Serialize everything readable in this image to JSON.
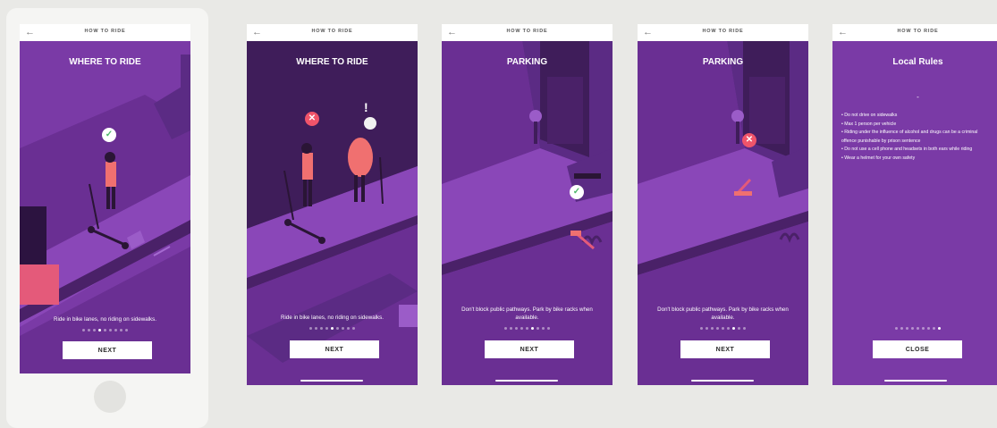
{
  "colors": {
    "purple": "#7a3aa6",
    "purple_dark": "#3f1d5a",
    "purple_mid": "#5b2b84",
    "coral": "#f06b6b",
    "check_green": "#4fb86b",
    "no_red": "#f0546a"
  },
  "top_bar": {
    "back_icon": "arrow-left-icon",
    "title": "HOW TO RIDE"
  },
  "screens": [
    {
      "heading": "WHERE TO RIDE",
      "description": "Ride in bike lanes, no riding on sidewalks.",
      "button": "NEXT",
      "page_total": 9,
      "page_active": 4,
      "marker": "check-icon"
    },
    {
      "heading": "WHERE TO RIDE",
      "description": "Ride in bike lanes, no riding on sidewalks.",
      "button": "NEXT",
      "page_total": 9,
      "page_active": 5,
      "marker": "cross-icon",
      "exclaim": "!"
    },
    {
      "heading": "PARKING",
      "description": "Don't block public pathways. Park by bike racks when available.",
      "button": "NEXT",
      "page_total": 9,
      "page_active": 6,
      "marker": "check-icon"
    },
    {
      "heading": "PARKING",
      "description": "Don't block public pathways. Park by bike racks when available.",
      "button": "NEXT",
      "page_total": 9,
      "page_active": 7,
      "marker": "cross-icon"
    },
    {
      "heading": "Local Rules",
      "dash": "-",
      "rules": [
        "• Do not drive on sidewalks",
        "• Max 1 person per vehicle",
        "• Riding under the influence of alcohol and drugs can be a criminal offence punishable by prison sentence",
        "• Do not use a cell phone and headsets in both ears while riding",
        "• Wear a helmet for your own safety"
      ],
      "button": "CLOSE",
      "page_total": 9,
      "page_active": 9
    }
  ],
  "marks": {
    "check": "✓",
    "cross": "✕"
  }
}
